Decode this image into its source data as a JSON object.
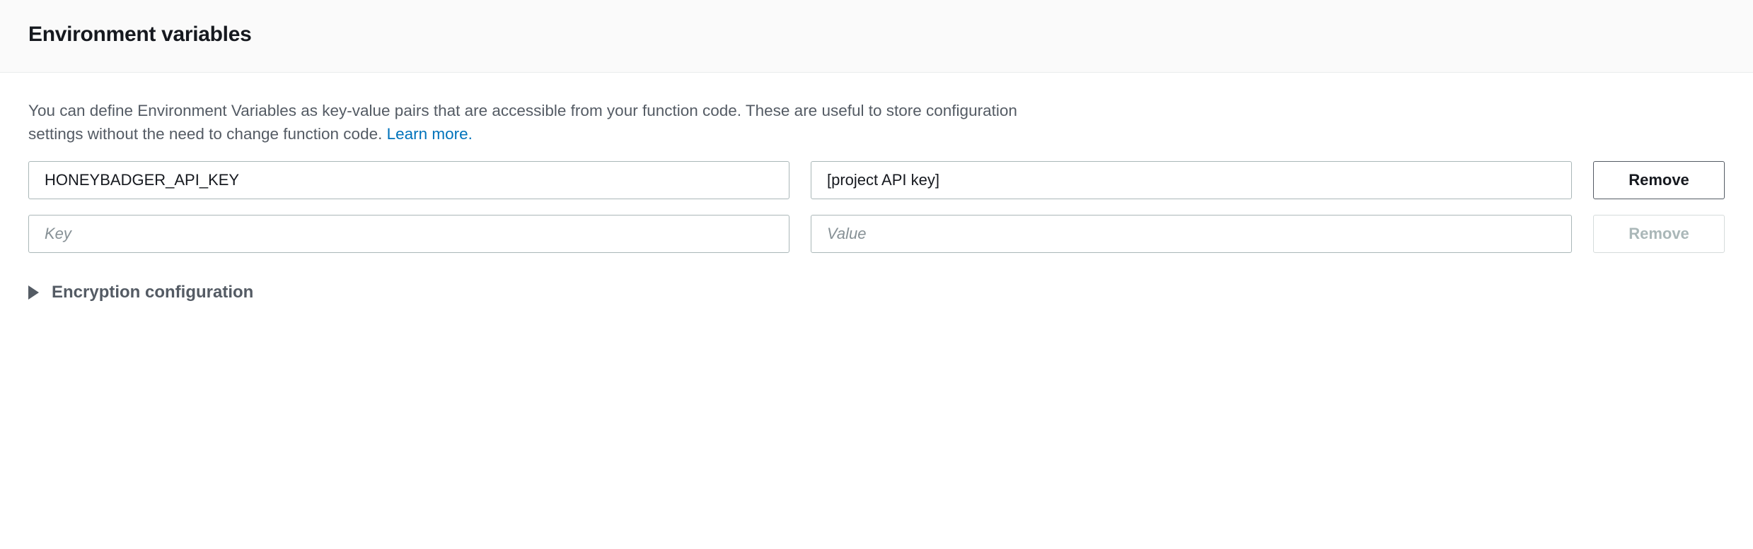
{
  "header": {
    "title": "Environment variables"
  },
  "body": {
    "description": "You can define Environment Variables as key-value pairs that are accessible from your function code. These are useful to store configuration settings without the need to change function code. ",
    "learn_more_label": "Learn more."
  },
  "rows": [
    {
      "key_value": "HONEYBADGER_API_KEY",
      "key_placeholder": "Key",
      "value_value": "[project API key]",
      "value_placeholder": "Value",
      "remove_label": "Remove",
      "remove_disabled": false
    },
    {
      "key_value": "",
      "key_placeholder": "Key",
      "value_value": "",
      "value_placeholder": "Value",
      "remove_label": "Remove",
      "remove_disabled": true
    }
  ],
  "expander": {
    "label": "Encryption configuration"
  }
}
